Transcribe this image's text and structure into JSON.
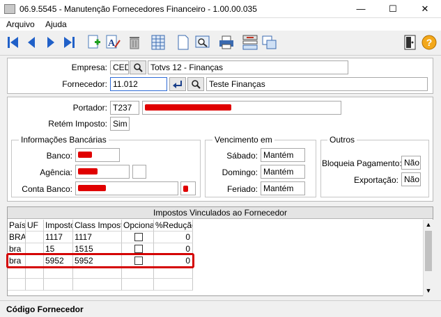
{
  "window": {
    "title": "06.9.5545 - Manutenção Fornecedores Financeiro - 1.00.00.035",
    "minimize": "—",
    "maximize": "☐",
    "close": "✕"
  },
  "menu": {
    "items": [
      "Arquivo",
      "Ajuda"
    ]
  },
  "toolbar": {
    "icons": [
      "first-record-icon",
      "previous-record-icon",
      "next-record-icon",
      "last-record-icon",
      "new-record-icon",
      "edit-text-icon",
      "delete-icon",
      "list-icon",
      "document-icon",
      "search-zoom-icon",
      "print-icon",
      "compare-icon",
      "copy-icon",
      "exit-door-icon",
      "help-icon"
    ],
    "help_label": "?"
  },
  "header": {
    "empresa_label": "Empresa:",
    "empresa_code": "CED",
    "empresa_name": "Totvs 12 - Finanças",
    "fornecedor_label": "Fornecedor:",
    "fornecedor_code": "11.012",
    "fornecedor_name": "Teste Finanças"
  },
  "details": {
    "portador_label": "Portador:",
    "portador_code": "T237",
    "retem_label": "Retém Imposto:",
    "retem_value": "Sim"
  },
  "bancarias": {
    "title": "Informações Bancárias",
    "banco_label": "Banco:",
    "agencia_label": "Agência:",
    "conta_label": "Conta Banco:"
  },
  "vencimento": {
    "title": "Vencimento em",
    "sabado_label": "Sábado:",
    "sabado_value": "Mantém",
    "domingo_label": "Domingo:",
    "domingo_value": "Mantém",
    "feriado_label": "Feriado:",
    "feriado_value": "Mantém"
  },
  "outros": {
    "title": "Outros",
    "bloqueia_label": "Bloqueia Pagamento:",
    "bloqueia_value": "Não",
    "exportacao_label": "Exportação:",
    "exportacao_value": "Não"
  },
  "grid": {
    "title": "Impostos Vinculados ao Fornecedor",
    "columns": [
      "País",
      "UF",
      "Imposto",
      "Class Imposto",
      "Opcional",
      "%Redução"
    ],
    "rows": [
      {
        "pais": "BRA",
        "uf": "",
        "imposto": "1117",
        "class": "1117",
        "opcional": false,
        "reducao": "0"
      },
      {
        "pais": "bra",
        "uf": "",
        "imposto": "15",
        "class": "1515",
        "opcional": false,
        "reducao": "0"
      },
      {
        "pais": "bra",
        "uf": "",
        "imposto": "5952",
        "class": "5952",
        "opcional": false,
        "reducao": "0"
      }
    ],
    "highlight_color": "#d40000"
  },
  "status": {
    "text": "Código Fornecedor"
  },
  "colors": {
    "redaction": "#e00000",
    "nav_blue": "#2060c8",
    "focus_border": "#2f6bd6"
  }
}
